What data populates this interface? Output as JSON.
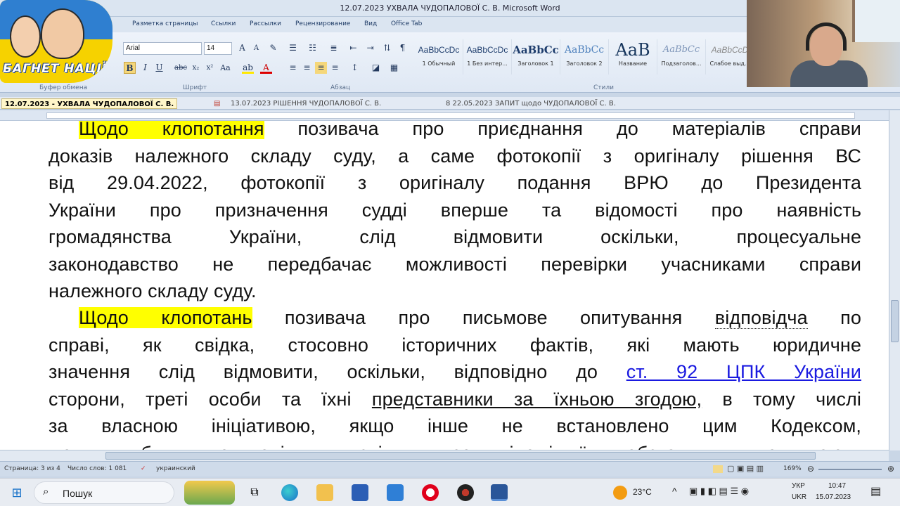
{
  "window": {
    "title": "12.07.2023    УХВАЛА ЧУДОПАЛОВОЇ С. В.    Microsoft Word"
  },
  "ribbon": {
    "tabs": [
      "Разметка страницы",
      "Ссылки",
      "Рассылки",
      "Рецензирование",
      "Вид",
      "Office Tab"
    ],
    "font_name": "Arial",
    "font_size": "14",
    "groups": [
      "Буфер обмена",
      "Шрифт",
      "Абзац",
      "Стили"
    ],
    "styles": [
      {
        "sample": "AaBbCcDc",
        "name": "1 Обычный"
      },
      {
        "sample": "AaBbCcDc",
        "name": "1 Без интер..."
      },
      {
        "sample": "AaBbCc",
        "name": "Заголовок 1"
      },
      {
        "sample": "AaBbCc",
        "name": "Заголовок 2"
      },
      {
        "sample": "AaB",
        "name": "Название"
      },
      {
        "sample": "AaBbCc",
        "name": "Подзаголов..."
      },
      {
        "sample": "AaBbCcD",
        "name": "Слабое выд..."
      }
    ]
  },
  "logo": {
    "text": "БАГНЕТ НАЦІЇ"
  },
  "doc_tabs": [
    "12.07.2023 - УХВАЛА ЧУДОПАЛОВОЇ С. В.",
    "13.07.2023    РІШЕННЯ ЧУДОПАЛОВОЇ С. В.",
    "8    22.05.2023    ЗАПИТ щодо ЧУДОПАЛОВОЇ С. В."
  ],
  "document": {
    "p1": {
      "highlight": "Щодо клопотання",
      "line1_rest": " позивача про приєднання до матеріалів справи",
      "line2": "доказів належного складу суду, а саме фотокопії з оригіналу рішення ВС",
      "line3": "від 29.04.2022, фотокопії з оригіналу подання ВРЮ до Президента",
      "line4": "України про призначення судді вперше та відомості про наявність",
      "line5": "громадянства України, слід відмовити оскільки, процесуальне",
      "line6": "законодавство не передбачає можливості перевірки учасниками справи",
      "line7": "належного складу суду."
    },
    "p2": {
      "highlight": "Щодо клопотань",
      "line1_a": " позивача про письмове опитування ",
      "line1_b": "відповідча",
      "line1_c": " по",
      "line2": "справі, як свідка, стосовно історичних фактів, які мають юридичне",
      "line3_a": "значення слід відмовити, оскільки, відповідно до ",
      "line3_link": "ст. 92 ЦПК України",
      "line4_a": "сторони, треті особи та їхні ",
      "line4_ul": "представники за їхньою згодою,",
      "line4_b": " в тому числі",
      "line5": "за власною ініціативою, якщо інше не встановлено цим Кодексом,",
      "line6": "можуть бути допитані як свідки про відомі їм обставини, що мають"
    }
  },
  "statusbar": {
    "page": "Страница: 3 из 4",
    "words": "Число слов: 1 081",
    "language": "украинский",
    "zoom": "169%"
  },
  "taskbar": {
    "search_label": "Пошук",
    "temperature": "23°C",
    "lang_top": "УКР",
    "lang_bottom": "UKR",
    "time": "10:47",
    "date": "15.07.2023"
  }
}
